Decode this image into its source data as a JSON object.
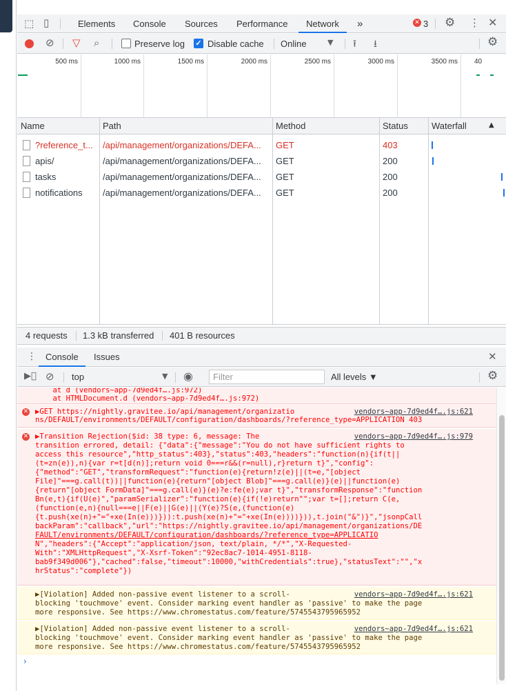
{
  "tabs": {
    "elements": "Elements",
    "console": "Console",
    "sources": "Sources",
    "performance": "Performance",
    "network": "Network",
    "more": "»",
    "error_count": "3"
  },
  "toolbar": {
    "preserve_log": "Preserve log",
    "disable_cache": "Disable cache",
    "throttle": "Online"
  },
  "overview": {
    "ticks": [
      "500 ms",
      "1000 ms",
      "1500 ms",
      "2000 ms",
      "2500 ms",
      "3000 ms",
      "3500 ms",
      "40"
    ]
  },
  "table": {
    "headers": {
      "name": "Name",
      "path": "Path",
      "method": "Method",
      "status": "Status",
      "waterfall": "Waterfall"
    },
    "rows": [
      {
        "name": "?reference_t...",
        "path": "/api/management/organizations/DEFA...",
        "method": "GET",
        "status": "403",
        "error": true
      },
      {
        "name": "apis/",
        "path": "/api/management/organizations/DEFA...",
        "method": "GET",
        "status": "200",
        "error": false
      },
      {
        "name": "tasks",
        "path": "/api/management/organizations/DEFA...",
        "method": "GET",
        "status": "200",
        "error": false
      },
      {
        "name": "notifications",
        "path": "/api/management/organizations/DEFA...",
        "method": "GET",
        "status": "200",
        "error": false
      }
    ]
  },
  "summary": {
    "requests": "4 requests",
    "transferred": "1.3 kB transferred",
    "resources": "401 B resources"
  },
  "drawer": {
    "console_tab": "Console",
    "issues_tab": "Issues",
    "context": "top",
    "filter_placeholder": "Filter",
    "levels": "All levels ▼"
  },
  "console": {
    "stack": [
      "    at d (vendors~app-7d9ed4f….js:972)",
      "    at HTMLDocument.d (vendors~app-7d9ed4f….js:972)"
    ],
    "get_error": {
      "line1": "▶GET https://nightly.gravitee.io/api/management/organizatio",
      "line2": "ns/DEFAULT/environments/DEFAULT/configuration/dashboards/?reference_type=APPLICATION 403",
      "source": "vendors~app-7d9ed4f….js:621"
    },
    "transition_error": {
      "source": "vendors~app-7d9ed4f….js:979",
      "lines": [
        "▶Transition Rejection($id: 38 type: 6, message: The",
        "transition errored, detail: {\"data\":{\"message\":\"You do not have sufficient rights to",
        "access this resource\",\"http_status\":403},\"status\":403,\"headers\":\"function(n){if(t||",
        "(t=zn(e)),n){var r=t[d(n)];return void 0===r&&(r=null),r}return t}\",\"config\":",
        "{\"method\":\"GET\",\"transformRequest\":\"function(e){return!z(e)||(t=e,\"[object",
        "File]\"===g.call(t))||function(e){return\"[object Blob]\"===g.call(e)}(e)||function(e)",
        "{return\"[object FormData]\"===g.call(e)}(e)?e:fe(e);var t}\",\"transformResponse\":\"function",
        "Bn(e,t){if(U(e)\",\"paramSerializer\":\"function(e){if(!e)return\"\";var t=[];return C(e,",
        "(function(e,n){null===e||F(e)||G(e)||(Y(e)?S(e,(function(e)",
        "{t.push(xe(n)+\"=\"+xe(In(e)))})):t.push(xe(n)+\"=\"+xe(In(e))))})),t.join(\"&\")}\",\"jsonpCall",
        "backParam\":\"callback\",\"url\":\"https://nightly.gravitee.io/api/management/organizations/DE",
        "FAULT/environments/DEFAULT/configuration/dashboards/?reference_type=APPLICATIO",
        "N\",\"headers\":{\"Accept\":\"application/json, text/plain, */*\",\"X-Requested-",
        "With\":\"XMLHttpRequest\",\"X-Xsrf-Token\":\"92ec8ac7-1014-4951-8118-",
        "bab9f349d006\"},\"cached\":false,\"timeout\":10000,\"withCredentials\":true},\"statusText\":\"\",\"x",
        "hrStatus\":\"complete\"})"
      ]
    },
    "violations": [
      {
        "source": "vendors~app-7d9ed4f….js:621",
        "lines": [
          "▶[Violation] Added non-passive event listener to a scroll-",
          "blocking 'touchmove' event. Consider marking event handler as 'passive' to make the page",
          "more responsive. See https://www.chromestatus.com/feature/5745543795965952"
        ]
      },
      {
        "source": "vendors~app-7d9ed4f….js:621",
        "lines": [
          "▶[Violation] Added non-passive event listener to a scroll-",
          "blocking 'touchmove' event. Consider marking event handler as 'passive' to make the page",
          "more responsive. See https://www.chromestatus.com/feature/5745543795965952"
        ]
      }
    ],
    "prompt": "›"
  },
  "colors": {
    "accent": "#1a73e8",
    "error": "#d93025",
    "record": "#e8453c"
  }
}
